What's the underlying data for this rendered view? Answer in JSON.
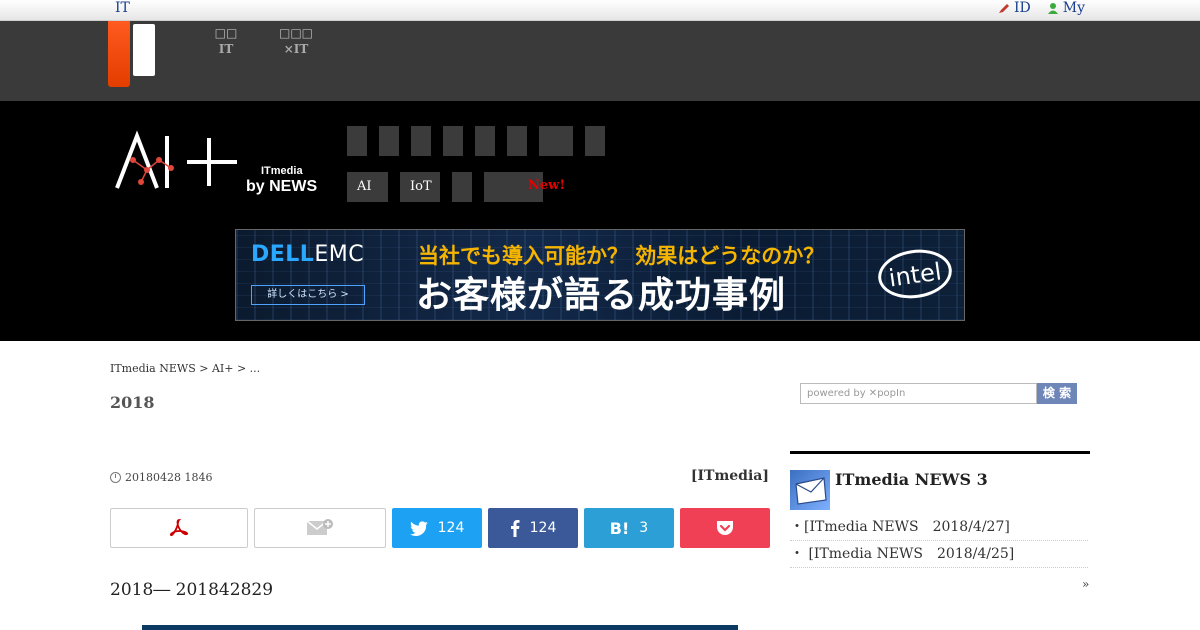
{
  "topbar": {
    "left_link": "IT",
    "id_link": "ID",
    "my_link": "My"
  },
  "header": {
    "nav": [
      {
        "line1": "□□",
        "line2": "IT"
      },
      {
        "line1": "□□□",
        "line2": "×IT"
      }
    ]
  },
  "category_nav": {
    "row2": [
      {
        "label": "AI"
      },
      {
        "label": "IoT"
      },
      {
        "label": ""
      },
      {
        "label": ""
      }
    ],
    "new_badge": "New!"
  },
  "ad": {
    "brand": "DELL",
    "brand_suffix": "EMC",
    "details": "詳しくはこちら >",
    "line1": "当社でも導入可能か？ 効果はどうなのか？",
    "line2": "お客様が語る成功事例",
    "intel": "intel"
  },
  "breadcrumb": "ITmedia NEWS > AI+ > ...",
  "article": {
    "year": "2018",
    "date": "20180428 1846",
    "author": "[ITmedia]",
    "headline": "2018―  201842829"
  },
  "share": {
    "twitter_count": "124",
    "facebook_count": "124",
    "hatena_label": "B!",
    "hatena_count": "3"
  },
  "search": {
    "placeholder": "powered by ✕popIn",
    "button": "検 索"
  },
  "sidebar": {
    "title": "ITmedia NEWS 3",
    "items": [
      {
        "text": "・[ITmedia NEWS　2018/4/27]"
      },
      {
        "text": "・ [ITmedia NEWS　2018/4/25]"
      }
    ],
    "more": "»"
  }
}
